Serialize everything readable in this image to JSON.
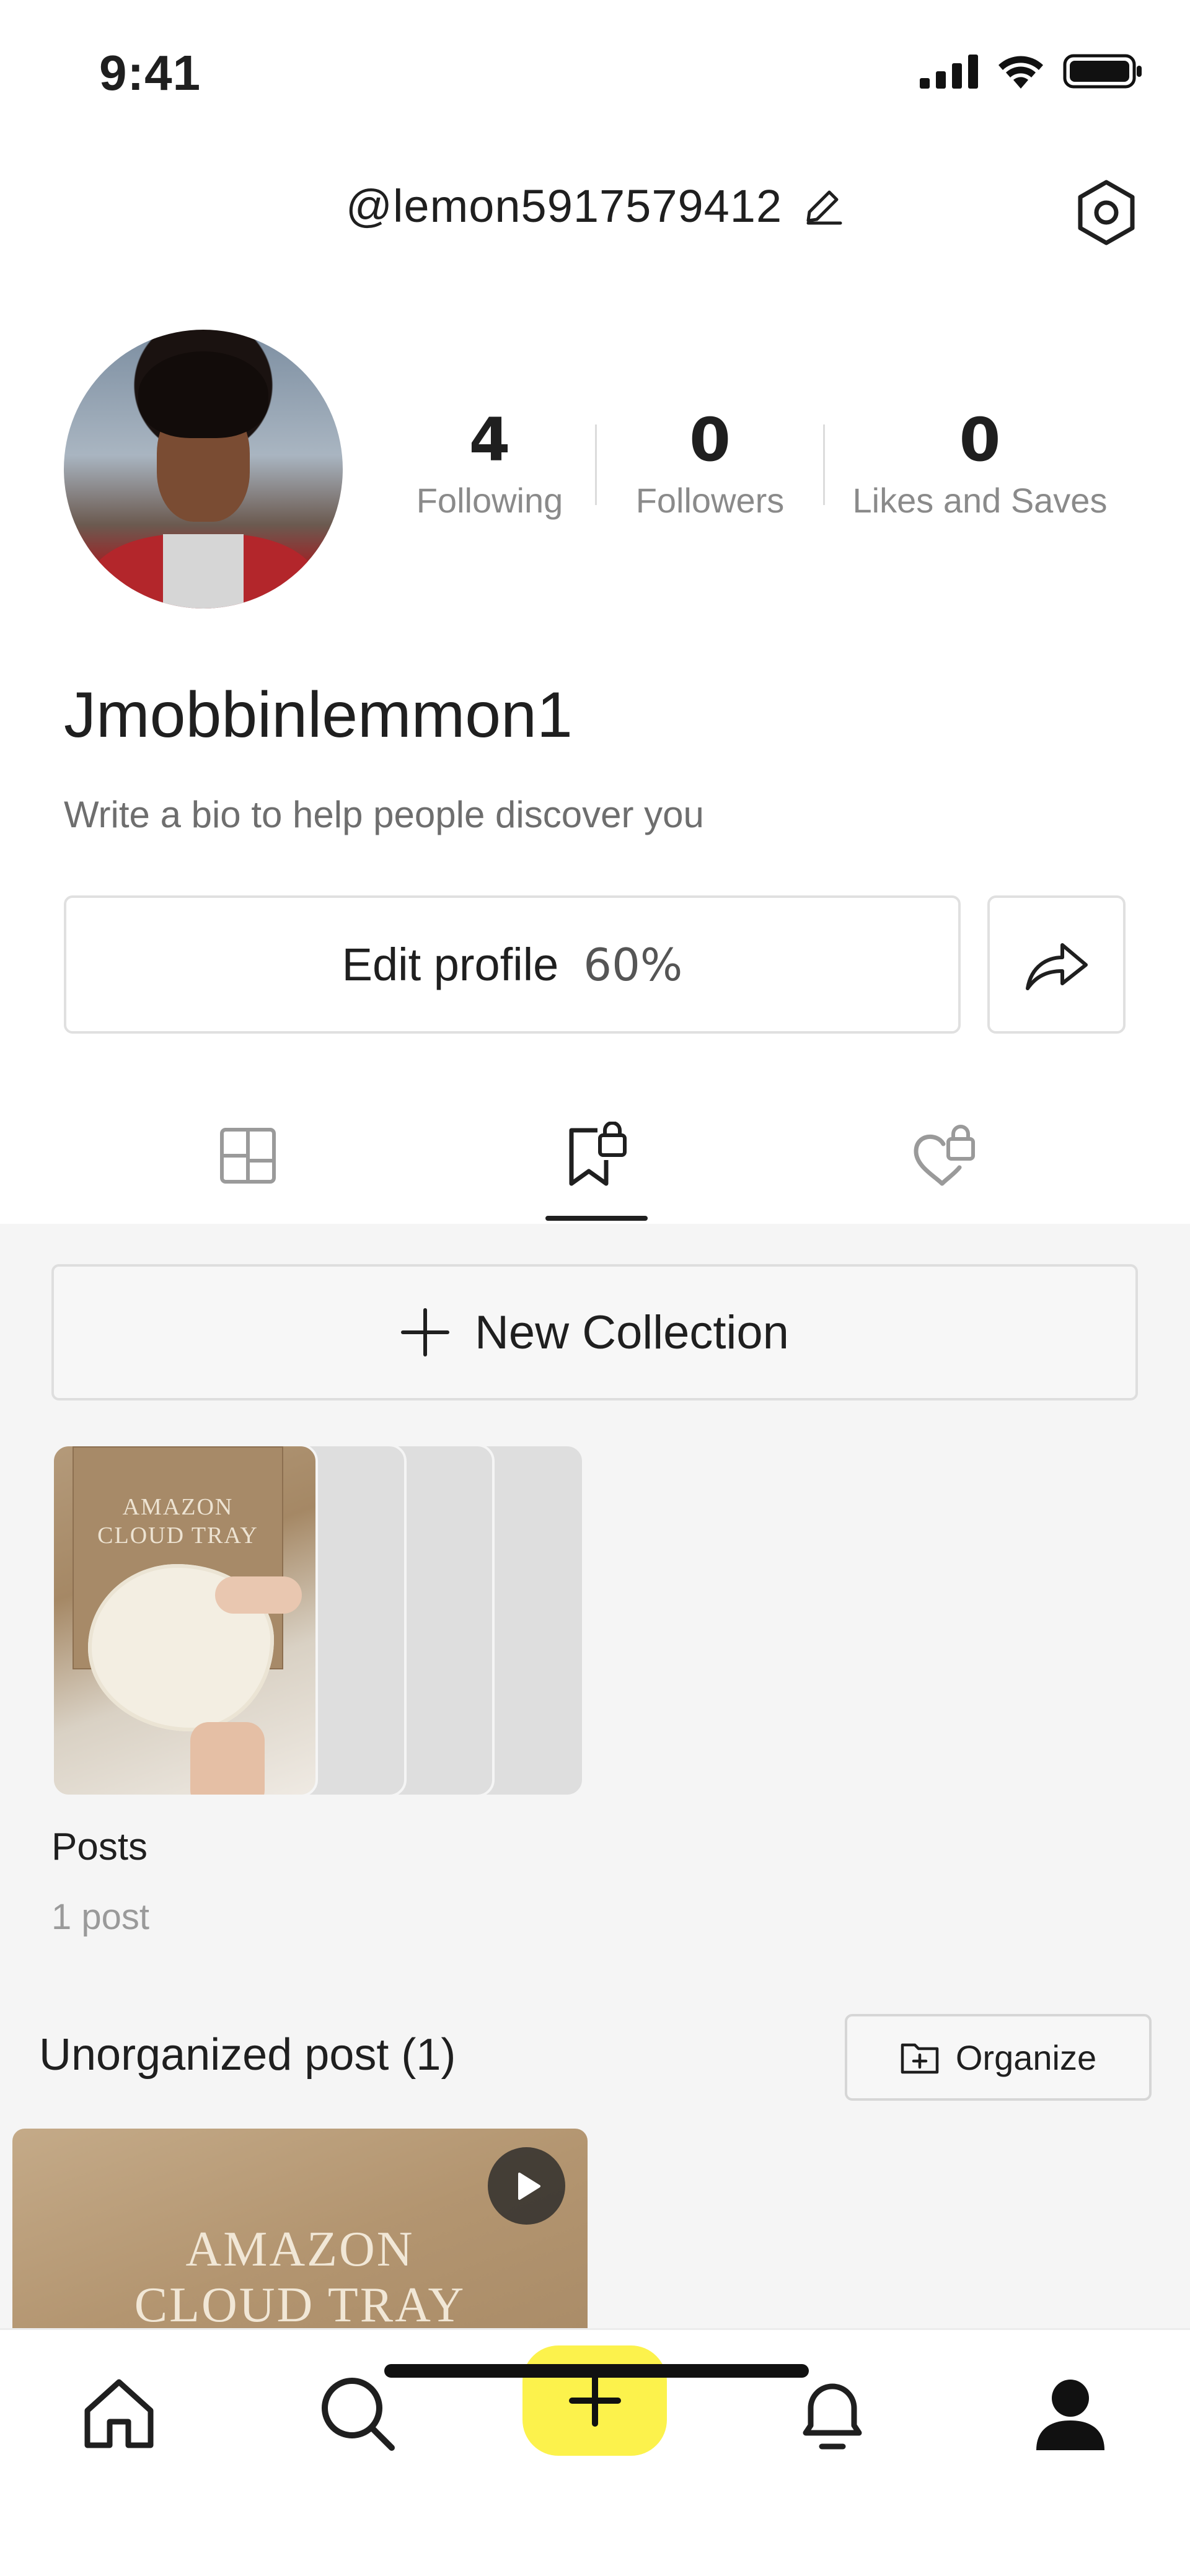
{
  "status_bar": {
    "time": "9:41"
  },
  "header": {
    "username": "@lemon5917579412"
  },
  "profile": {
    "stats": [
      {
        "value": "4",
        "label": "Following"
      },
      {
        "value": "0",
        "label": "Followers"
      },
      {
        "value": "0",
        "label": "Likes and Saves"
      }
    ],
    "display_name": "Jmobbinlemmon1",
    "bio_placeholder": "Write a bio to help people discover you",
    "edit_profile_label": "Edit profile",
    "profile_completion": "60%"
  },
  "tabs": [
    {
      "icon": "grid-icon",
      "active": false
    },
    {
      "icon": "bookmark-lock-icon",
      "active": true
    },
    {
      "icon": "heart-lock-icon",
      "active": false
    }
  ],
  "collections": {
    "new_collection_label": "New Collection",
    "items": [
      {
        "title": "Posts",
        "count": "1 post",
        "cover_text": [
          "AMAZON",
          "CLOUD TRAY"
        ]
      }
    ]
  },
  "unorganized": {
    "title": "Unorganized post (1)",
    "organize_label": "Organize",
    "posts": [
      {
        "thumb_text": [
          "AMAZON",
          "CLOUD TRAY"
        ],
        "type": "video"
      }
    ]
  },
  "bottom_nav": [
    "home-icon",
    "search-icon",
    "create-icon",
    "bell-icon",
    "profile-icon"
  ],
  "colors": {
    "accent_yellow": "#fcf24c",
    "text": "#1f1f1f",
    "muted": "#8a8a8a",
    "background_gray": "#f5f5f5"
  }
}
